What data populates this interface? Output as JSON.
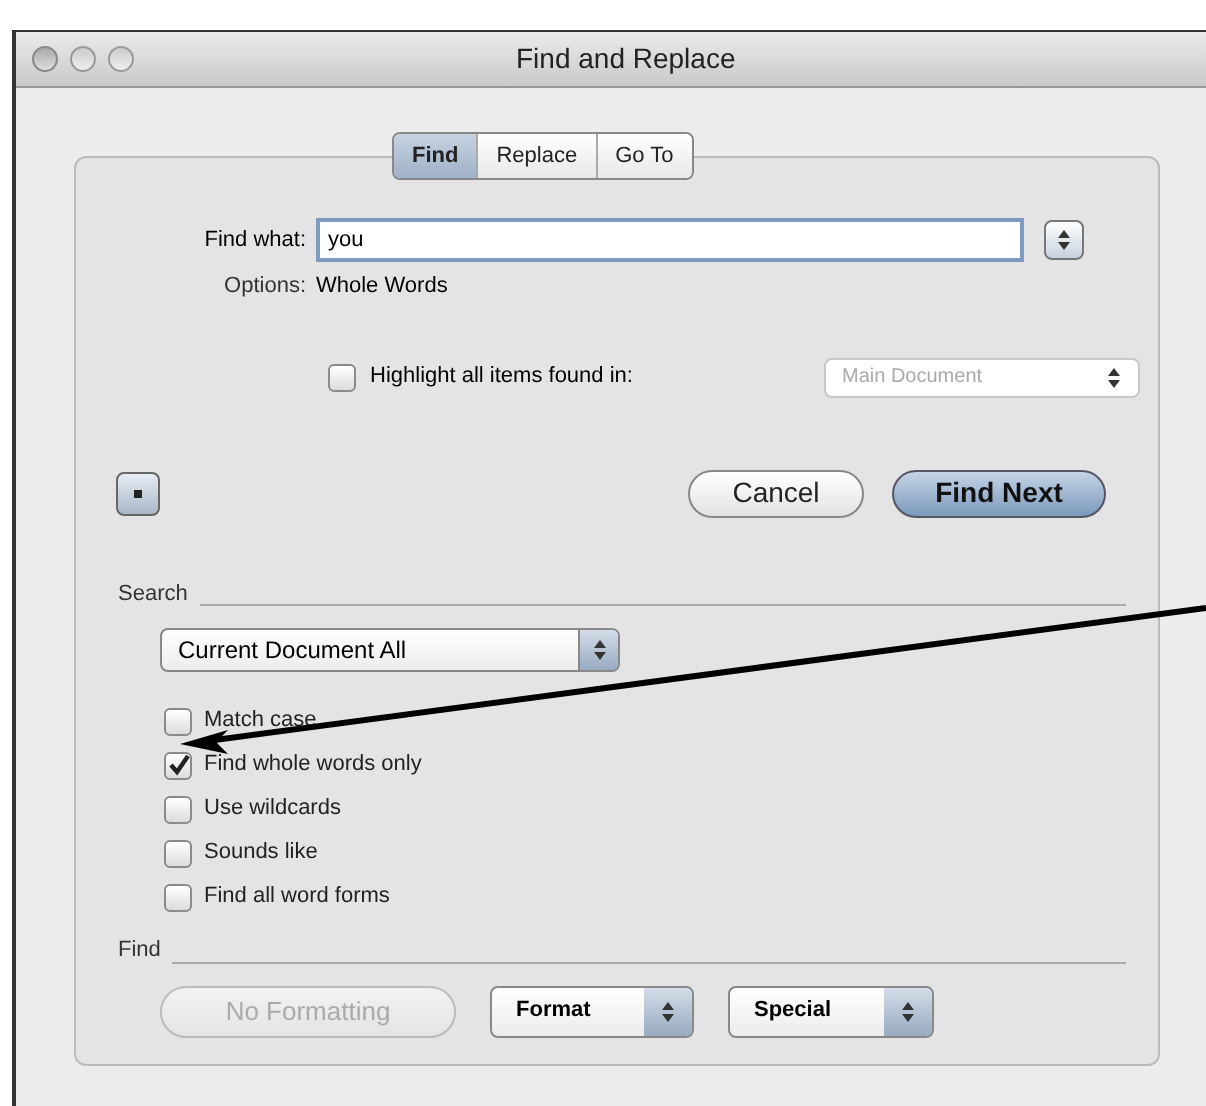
{
  "window": {
    "title": "Find and Replace"
  },
  "tabs": [
    {
      "label": "Find",
      "selected": true
    },
    {
      "label": "Replace",
      "selected": false
    },
    {
      "label": "Go To",
      "selected": false
    }
  ],
  "find_what": {
    "label": "Find what:",
    "value": "you"
  },
  "options": {
    "label": "Options:",
    "value": "Whole Words"
  },
  "highlight": {
    "label": "Highlight all items found in:",
    "checked": false,
    "dropdown": "Main Document",
    "disabled": true
  },
  "buttons": {
    "cancel": "Cancel",
    "find_next": "Find Next"
  },
  "search": {
    "heading": "Search",
    "scope": "Current Document All",
    "checkboxes": [
      {
        "label": "Match case",
        "checked": false
      },
      {
        "label": "Find whole words only",
        "checked": true
      },
      {
        "label": "Use wildcards",
        "checked": false
      },
      {
        "label": "Sounds like",
        "checked": false
      },
      {
        "label": "Find all word forms",
        "checked": false
      }
    ]
  },
  "find": {
    "heading": "Find",
    "no_formatting": {
      "label": "No Formatting",
      "disabled": true
    },
    "format": "Format",
    "special": "Special"
  }
}
